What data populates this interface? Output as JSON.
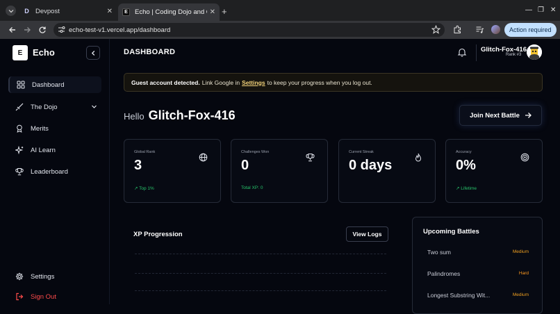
{
  "browser": {
    "tabs": [
      {
        "label": "Devpost",
        "favicon": "D"
      },
      {
        "label": "Echo | Coding Dojo and C",
        "favicon": "E"
      }
    ],
    "url": "echo-test-v1.vercel.app/dashboard",
    "action_required": "Action required"
  },
  "sidebar": {
    "brand": "Echo",
    "logo_letter": "E",
    "items": [
      {
        "label": "Dashboard",
        "icon": "dashboard-icon"
      },
      {
        "label": "The Dojo",
        "icon": "sword-icon"
      },
      {
        "label": "Merits",
        "icon": "medal-icon"
      },
      {
        "label": "AI Learn",
        "icon": "sparkle-icon"
      },
      {
        "label": "Leaderboard",
        "icon": "trophy-icon"
      }
    ],
    "settings": "Settings",
    "signout": "Sign Out"
  },
  "header": {
    "title": "DASHBOARD",
    "user_name": "Glitch-Fox-416",
    "user_rank": "Rank #3"
  },
  "banner": {
    "bold": "Guest account detected.",
    "pre": "Link Google in",
    "link": "Settings",
    "post": "to keep your progress when you log out."
  },
  "greeting": {
    "hello": "Hello",
    "name": "Glitch-Fox-416",
    "join_button": "Join Next Battle"
  },
  "stats": [
    {
      "label": "Global Rank",
      "value": "3",
      "footer": "Top 1%",
      "icon": "globe-icon"
    },
    {
      "label": "Challenges Won",
      "value": "0",
      "footer": "Total XP: 0",
      "icon": "trophy-icon"
    },
    {
      "label": "Current Streak",
      "value": "0 days",
      "footer": "",
      "icon": "flame-icon"
    },
    {
      "label": "Accuracy",
      "value": "0%",
      "footer": "Lifetime",
      "icon": "target-icon"
    }
  ],
  "xp": {
    "title": "XP Progression",
    "button": "View Logs"
  },
  "upcoming": {
    "title": "Upcoming Battles",
    "battles": [
      {
        "name": "Two sum",
        "difficulty": "Medium"
      },
      {
        "name": "Palindromes",
        "difficulty": "Hard"
      },
      {
        "name": "Longest Substring Wit...",
        "difficulty": "Medium"
      }
    ]
  },
  "colors": {
    "accent_green": "#27c46b",
    "medium": "#f0a020",
    "hard": "#ff9a1f",
    "signout": "#ff4b4b"
  }
}
